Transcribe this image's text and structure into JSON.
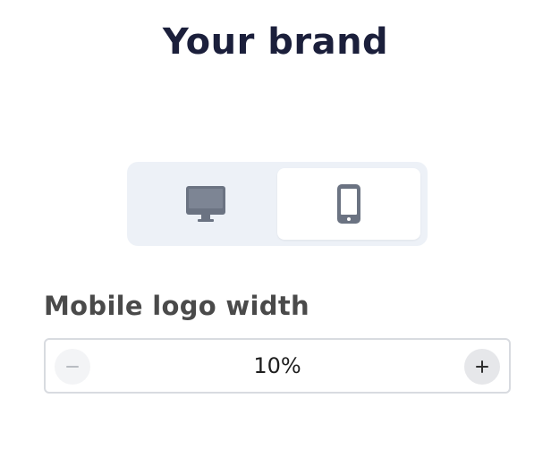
{
  "header": {
    "title": "Your brand"
  },
  "device_toggle": {
    "options": [
      {
        "icon": "desktop-monitor-icon",
        "selected": false
      },
      {
        "icon": "mobile-phone-icon",
        "selected": true
      }
    ]
  },
  "logo_width": {
    "label": "Mobile logo width",
    "value": "10%",
    "decrement_icon": "minus-icon",
    "increment_icon": "plus-icon"
  },
  "colors": {
    "title": "#1b1f3b",
    "label": "#4a4a4a",
    "toggle_bg": "#edf1f7",
    "icon_gray": "#6b7382"
  }
}
